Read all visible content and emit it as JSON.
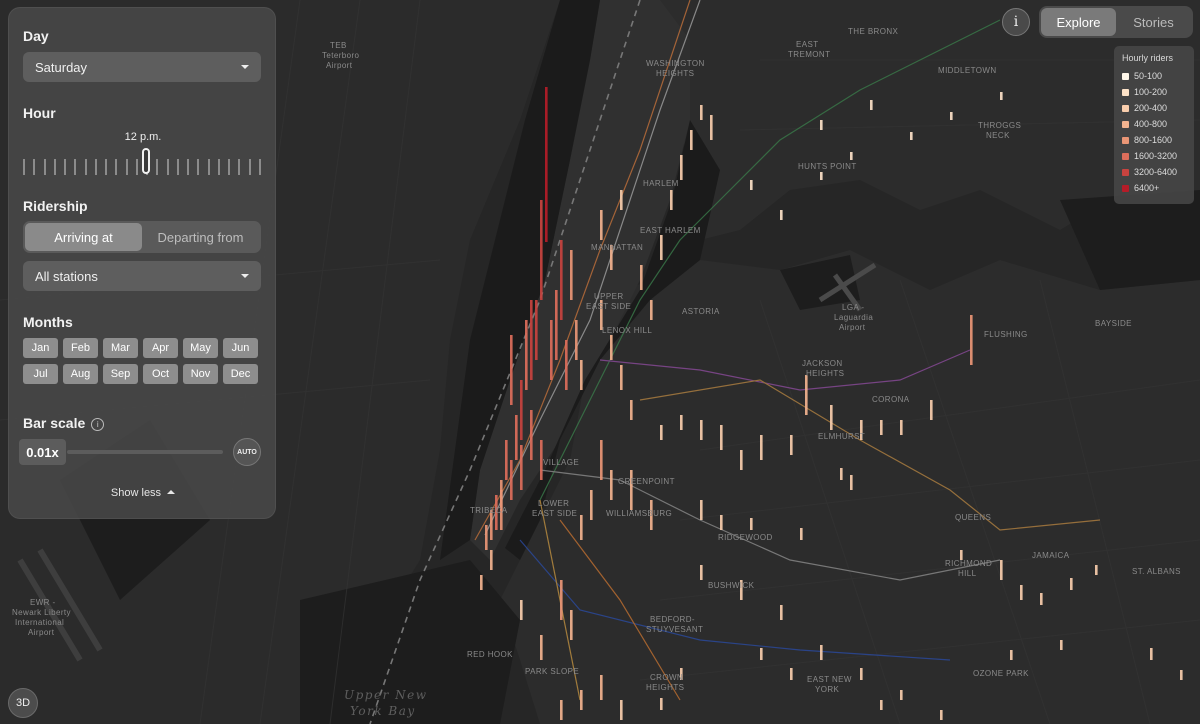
{
  "controls": {
    "day": {
      "title": "Day",
      "value": "Saturday"
    },
    "hour": {
      "title": "Hour",
      "value": "12 p.m.",
      "position": 0.5
    },
    "ridership": {
      "title": "Ridership",
      "tabs": [
        "Arriving at",
        "Departing from"
      ],
      "active_tab": "Arriving at",
      "station_filter": "All stations"
    },
    "months": {
      "title": "Months",
      "items": [
        "Jan",
        "Feb",
        "Mar",
        "Apr",
        "May",
        "Jun",
        "Jul",
        "Aug",
        "Sep",
        "Oct",
        "Nov",
        "Dec"
      ]
    },
    "bar_scale": {
      "title": "Bar scale",
      "value": "0.01x",
      "auto_label": "AUTO"
    },
    "show_less": "Show less"
  },
  "top_nav": {
    "info_icon": "i",
    "tabs": [
      "Explore",
      "Stories"
    ],
    "active": "Explore"
  },
  "legend": {
    "title": "Hourly riders",
    "items": [
      {
        "label": "50-100",
        "color": "#fff7ea"
      },
      {
        "label": "100-200",
        "color": "#fde2c8"
      },
      {
        "label": "200-400",
        "color": "#f9cdac"
      },
      {
        "label": "400-800",
        "color": "#f3b38f"
      },
      {
        "label": "800-1600",
        "color": "#ea9676"
      },
      {
        "label": "1600-3200",
        "color": "#dd6e5b"
      },
      {
        "label": "3200-6400",
        "color": "#c8433f"
      },
      {
        "label": "6400+",
        "color": "#b51c28"
      }
    ]
  },
  "map": {
    "places": [
      "TEB",
      "Teterboro",
      "Airport",
      "WASHINGTON",
      "HEIGHTS",
      "EAST",
      "TREMONT",
      "THE BRONX",
      "MIDDLETOWN",
      "THROGGS",
      "NECK",
      "HUNTS POINT",
      "HARLEM",
      "EAST HARLEM",
      "MANHATTAN",
      "UPPER",
      "EAST SIDE",
      "LENOX HILL",
      "ASTORIA",
      "LGA -",
      "Laguardia",
      "Airport",
      "FLUSHING",
      "BAYSIDE",
      "JACKSON",
      "HEIGHTS",
      "CORONA",
      "ELMHURST",
      "VILLAGE",
      "GREENPOINT",
      "TRIBECA",
      "LOWER",
      "EAST SIDE",
      "WILLIAMSBURG",
      "RIDGEWOOD",
      "QUEENS",
      "RICHMOND",
      "HILL",
      "JAMAICA",
      "ST. ALBANS",
      "BUSHWICK",
      "BEDFORD-",
      "STUYVESANT",
      "RED HOOK",
      "PARK SLOPE",
      "CROWN",
      "HEIGHTS",
      "EAST NEW",
      "YORK",
      "OZONE PARK",
      "EWR -",
      "Newark Liberty",
      "International",
      "Airport"
    ],
    "water_labels": [
      "Upper New",
      "York Bay"
    ]
  },
  "view_toggle": "3D"
}
